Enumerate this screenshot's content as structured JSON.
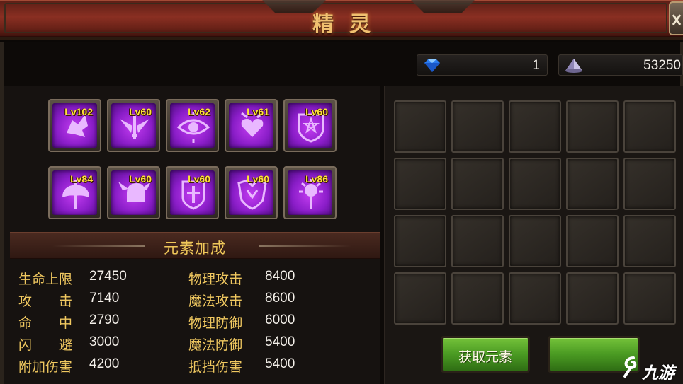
{
  "header": {
    "title": "精灵"
  },
  "currency": {
    "gems": {
      "value": "1",
      "icon": "diamond-icon"
    },
    "silver": {
      "value": "53250",
      "icon": "silver-crystal-icon"
    }
  },
  "elements": [
    {
      "level": "Lv102",
      "icon": "wing-claw-icon"
    },
    {
      "level": "Lv60",
      "icon": "winged-sword-icon"
    },
    {
      "level": "Lv62",
      "icon": "eye-icon"
    },
    {
      "level": "Lv61",
      "icon": "heart-cross-icon"
    },
    {
      "level": "Lv60",
      "icon": "star-shield-icon"
    },
    {
      "level": "Lv84",
      "icon": "double-axe-icon"
    },
    {
      "level": "Lv60",
      "icon": "winged-helmet-icon"
    },
    {
      "level": "Lv60",
      "icon": "cross-shield-icon"
    },
    {
      "level": "Lv60",
      "icon": "armor-icon"
    },
    {
      "level": "Lv86",
      "icon": "spiked-mace-icon"
    }
  ],
  "bonus": {
    "title": "元素加成",
    "stats": [
      {
        "name": "生命上限",
        "value": "27450"
      },
      {
        "name": "物理攻击",
        "value": "8400"
      },
      {
        "name": "攻　　击",
        "value": "7140"
      },
      {
        "name": "魔法攻击",
        "value": "8600"
      },
      {
        "name": "命　　中",
        "value": "2790"
      },
      {
        "name": "物理防御",
        "value": "6000"
      },
      {
        "name": "闪　　避",
        "value": "3000"
      },
      {
        "name": "魔法防御",
        "value": "5400"
      },
      {
        "name": "附加伤害",
        "value": "4200"
      },
      {
        "name": "抵挡伤害",
        "value": "5400"
      }
    ]
  },
  "inventory": {
    "slot_count": 20
  },
  "buttons": {
    "get_elements": "获取元素"
  },
  "watermark": {
    "text": "九游",
    "icon": "jiuyou-logo-icon"
  },
  "colors": {
    "gold": "#f0c860",
    "element_purple": "#a22ce0",
    "button_green": "#4a9a22",
    "title_red": "#8a2f22"
  }
}
